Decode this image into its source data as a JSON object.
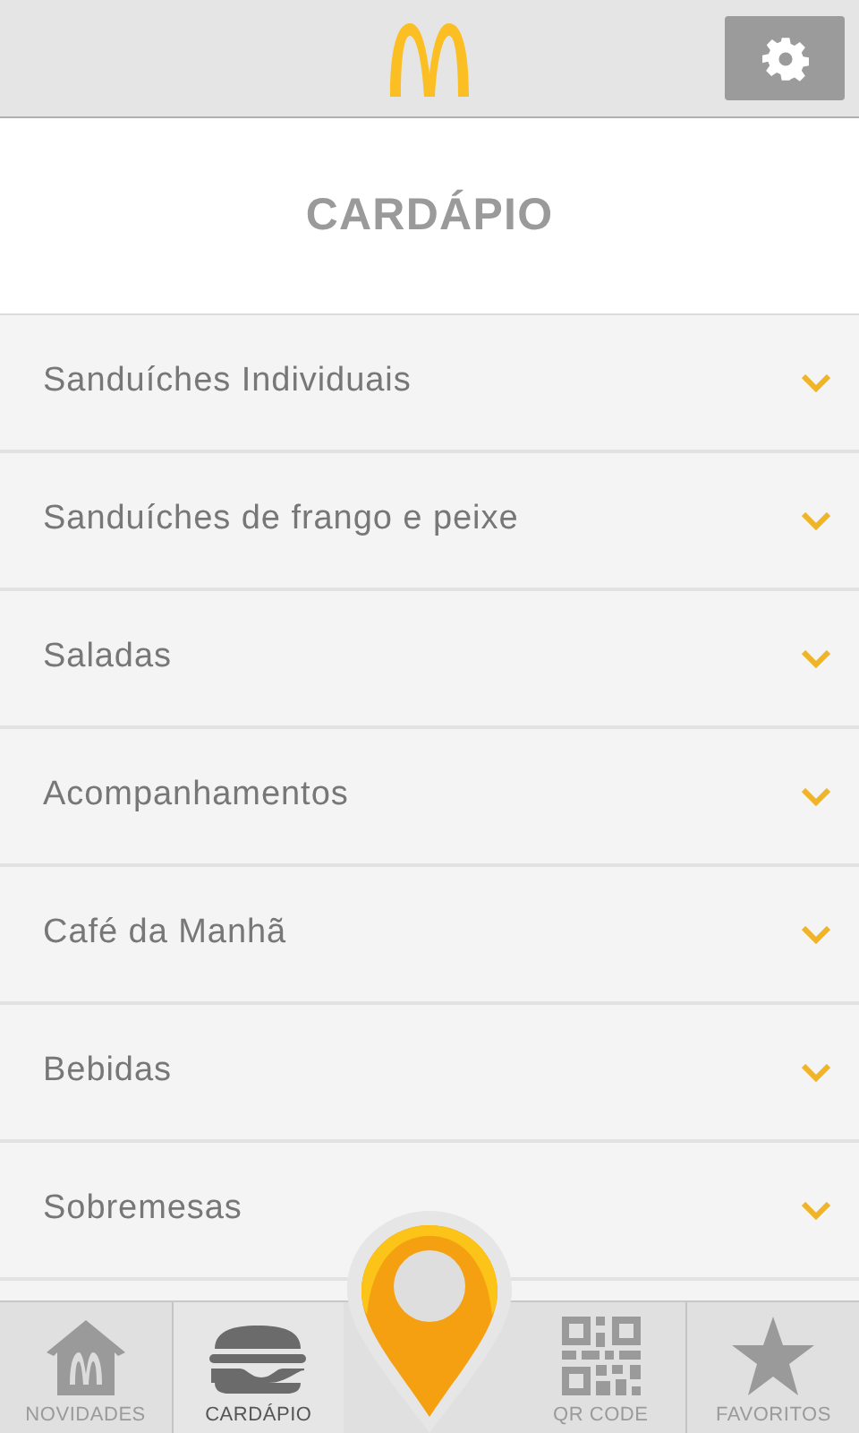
{
  "title": "CARDÁPIO",
  "categories": [
    {
      "label": "Sanduíches Individuais"
    },
    {
      "label": "Sanduíches de frango e peixe"
    },
    {
      "label": "Saladas"
    },
    {
      "label": "Acompanhamentos"
    },
    {
      "label": "Café da Manhã"
    },
    {
      "label": "Bebidas"
    },
    {
      "label": "Sobremesas"
    }
  ],
  "tabs": [
    {
      "label": "NOVIDADES",
      "kind": "home",
      "selected": false
    },
    {
      "label": "CARDÁPIO",
      "kind": "burger",
      "selected": true
    },
    {
      "label": "QR CODE",
      "kind": "qr",
      "selected": false
    },
    {
      "label": "FAVORITOS",
      "kind": "star",
      "selected": false
    }
  ]
}
